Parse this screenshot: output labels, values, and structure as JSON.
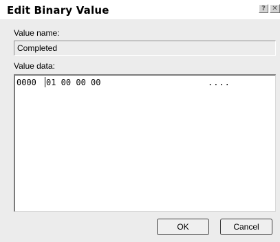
{
  "window": {
    "title": "Edit Binary Value",
    "help_glyph": "?",
    "close_glyph": "✕"
  },
  "value_name": {
    "label": "Value name:",
    "value": "Completed"
  },
  "value_data": {
    "label": "Value data:",
    "rows": [
      {
        "offset": "0000",
        "bytes": "01 00 00 00",
        "ascii": "...."
      }
    ]
  },
  "buttons": {
    "ok_label": "OK",
    "cancel_label": "Cancel"
  }
}
